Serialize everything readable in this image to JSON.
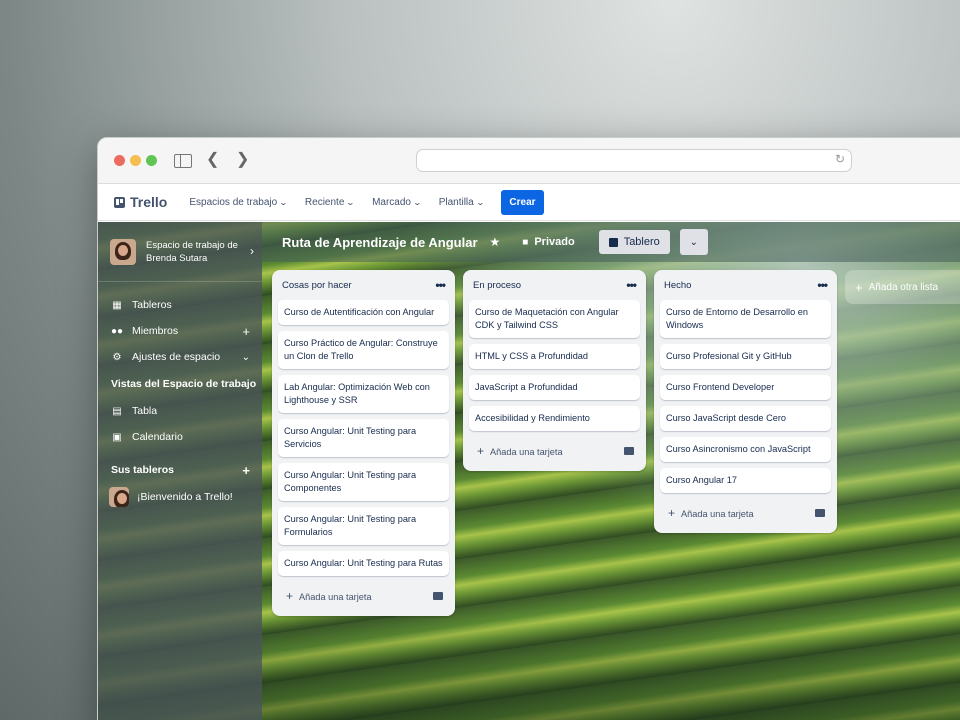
{
  "header": {
    "logo": "Trello",
    "menu": [
      "Espacios de trabajo",
      "Reciente",
      "Marcado",
      "Plantilla"
    ],
    "create": "Crear"
  },
  "sidebar": {
    "workspace": "Espacio de trabajo de Brenda Sutara",
    "items": [
      {
        "label": "Tableros",
        "icon": "trello-icon"
      },
      {
        "label": "Miembros",
        "icon": "members-icon"
      },
      {
        "label": "Ajustes de espacio",
        "icon": "gear-icon"
      }
    ],
    "views_title": "Vistas del Espacio de trabajo",
    "views": [
      {
        "label": "Tabla",
        "icon": "table-icon"
      },
      {
        "label": "Calendario",
        "icon": "calendar-icon"
      }
    ],
    "boards_title": "Sus tableros",
    "boards": [
      "¡Bienvenido a Trello!"
    ]
  },
  "board": {
    "title": "Ruta de Aprendizaje de Angular",
    "visibility": "Privado",
    "view": "Tablero"
  },
  "lists": [
    {
      "title": "Cosas por hacer",
      "cards": [
        "Curso de Autentificación con Angular",
        "Curso Práctico de Angular: Construye un Clon de Trello",
        "Lab Angular: Optimización Web con Lighthouse y SSR",
        "Curso Angular: Unit Testing para Servicios",
        "Curso Angular: Unit Testing para Componentes",
        "Curso Angular: Unit Testing para Formularios",
        "Curso Angular: Unit Testing para Rutas"
      ],
      "add": "Añada una tarjeta"
    },
    {
      "title": "En proceso",
      "cards": [
        "Curso de Maquetación con Angular CDK y Tailwind CSS",
        "HTML y CSS a Profundidad",
        "JavaScript a Profundidad",
        "Accesibilidad y Rendimiento"
      ],
      "add": "Añada una tarjeta"
    },
    {
      "title": "Hecho",
      "cards": [
        "Curso de Entorno de Desarrollo en Windows",
        "Curso Profesional Git y GitHub",
        "Curso Frontend Developer",
        "Curso JavaScript desde Cero",
        "Curso Asincronismo con JavaScript",
        "Curso Angular 17"
      ],
      "add": "Añada una tarjeta"
    }
  ],
  "add_list": "Añada otra lista"
}
